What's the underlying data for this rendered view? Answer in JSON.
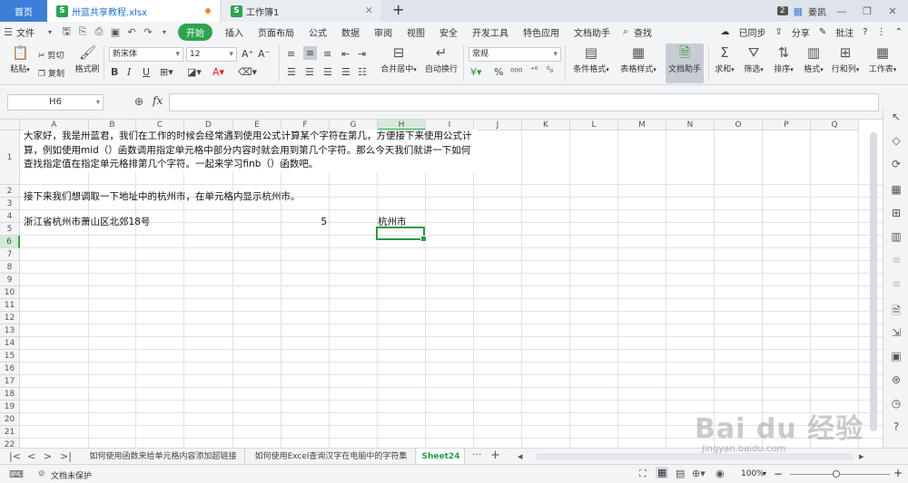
{
  "titlebar": {
    "home_tab": "首页",
    "file_tab": "卅蓝共享教程.xlsx",
    "file_logo": "S",
    "book_tab": "工作簿1",
    "new_tab": "+",
    "badge": "2",
    "user": "姜凯",
    "icons": [
      "new-tab-icon",
      "avatar-icon",
      "minimize-icon",
      "restore-icon",
      "close-icon"
    ]
  },
  "menubar": {
    "file": "文件",
    "tabs": [
      "开始",
      "插入",
      "页面布局",
      "公式",
      "数据",
      "审阅",
      "视图",
      "安全",
      "开发工具",
      "特色应用",
      "文档助手"
    ],
    "search": "查找",
    "sync": "已同步",
    "share": "分享",
    "comment": "批注"
  },
  "ribbon": {
    "paste": "粘贴",
    "cut": "剪切",
    "copy": "复制",
    "format_painter": "格式刷",
    "font_name": "新宋体",
    "font_size": "12",
    "merge_center": "合并居中",
    "wrap_text": "自动换行",
    "number_format": "常规",
    "conditional_format": "条件格式",
    "table_style": "表格样式",
    "doc_assistant": "文档助手",
    "sum": "求和",
    "filter": "筛选",
    "sort": "排序",
    "format": "格式",
    "rows_cols": "行和列",
    "worksheet": "工作表"
  },
  "formula_bar": {
    "name_box": "H6",
    "fx": "fx",
    "value": ""
  },
  "grid": {
    "columns": [
      "A",
      "B",
      "C",
      "D",
      "E",
      "F",
      "G",
      "H",
      "I",
      "J",
      "K",
      "L",
      "M",
      "N",
      "O",
      "P",
      "Q"
    ],
    "active_column": "H",
    "rows": [
      "1",
      "2",
      "3",
      "4",
      "5",
      "6",
      "7",
      "8",
      "9",
      "10",
      "11",
      "12",
      "13",
      "14",
      "15",
      "16",
      "17",
      "18",
      "19",
      "20",
      "21",
      "22",
      "23",
      "24",
      "25"
    ],
    "active_row": "6",
    "cells": {
      "A1": "大家好，我是卅蓝君，我们在工作的时候会经常遇到使用公式计算某个字符在第几，方便接下来使用公式计算，例如使用mid（）函数调用指定单元格中部分内容时就会用到第几个字符。那么今天我们就讲一下如何查找指定值在指定单元格排第几个字符。一起来学习finb（）函数吧。",
      "A3": "接下来我们想调取一下地址中的杭州市，在单元格内显示杭州市。",
      "A5": "浙江省杭州市萧山区北郊18号",
      "F5": "5",
      "H5": "杭州市"
    }
  },
  "sheets": {
    "tabs": [
      "如何使用函数来给单元格内容添加超链接",
      "如何使用Excel查询汉字在电脑中的字符集",
      "Sheet24"
    ],
    "active": "Sheet24",
    "more": "···",
    "add": "+"
  },
  "statusbar": {
    "protect": "文档未保护",
    "zoom": "100%",
    "zoom_minus": "−",
    "zoom_plus": "+"
  },
  "watermark": {
    "logo": "Bai du 经验",
    "url": "jingyan.baidu.com"
  }
}
